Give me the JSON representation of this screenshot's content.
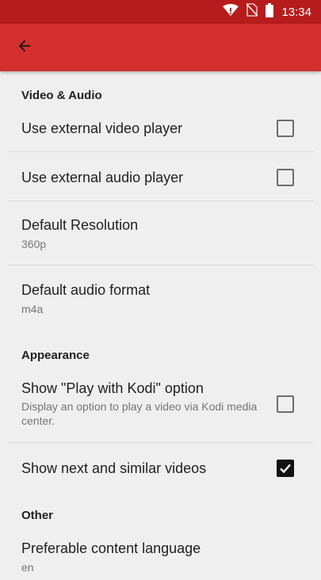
{
  "status_bar": {
    "time": "13:34",
    "icons": [
      "wifi-icon",
      "no-sim-icon",
      "battery-icon"
    ]
  },
  "toolbar": {
    "back_icon": "arrow-back-icon"
  },
  "sections": {
    "video_audio": {
      "header": "Video & Audio"
    },
    "appearance": {
      "header": "Appearance"
    },
    "other": {
      "header": "Other"
    }
  },
  "prefs": {
    "external_video": {
      "title": "Use external video player",
      "checked": false
    },
    "external_audio": {
      "title": "Use external audio player",
      "checked": false
    },
    "default_resolution": {
      "title": "Default Resolution",
      "summary": "360p"
    },
    "default_audio_format": {
      "title": "Default audio format",
      "summary": "m4a"
    },
    "play_with_kodi": {
      "title": "Show \"Play with Kodi\" option",
      "summary": "Display an option to play a video via Kodi media center.",
      "checked": false
    },
    "next_similar": {
      "title": "Show next and similar videos",
      "checked": true
    },
    "content_language": {
      "title": "Preferable content language",
      "summary": "en"
    }
  },
  "colors": {
    "status_bar": "#b71c1c",
    "toolbar": "#d32f2f",
    "background": "#efefef",
    "checkbox_checked": "#121212"
  }
}
